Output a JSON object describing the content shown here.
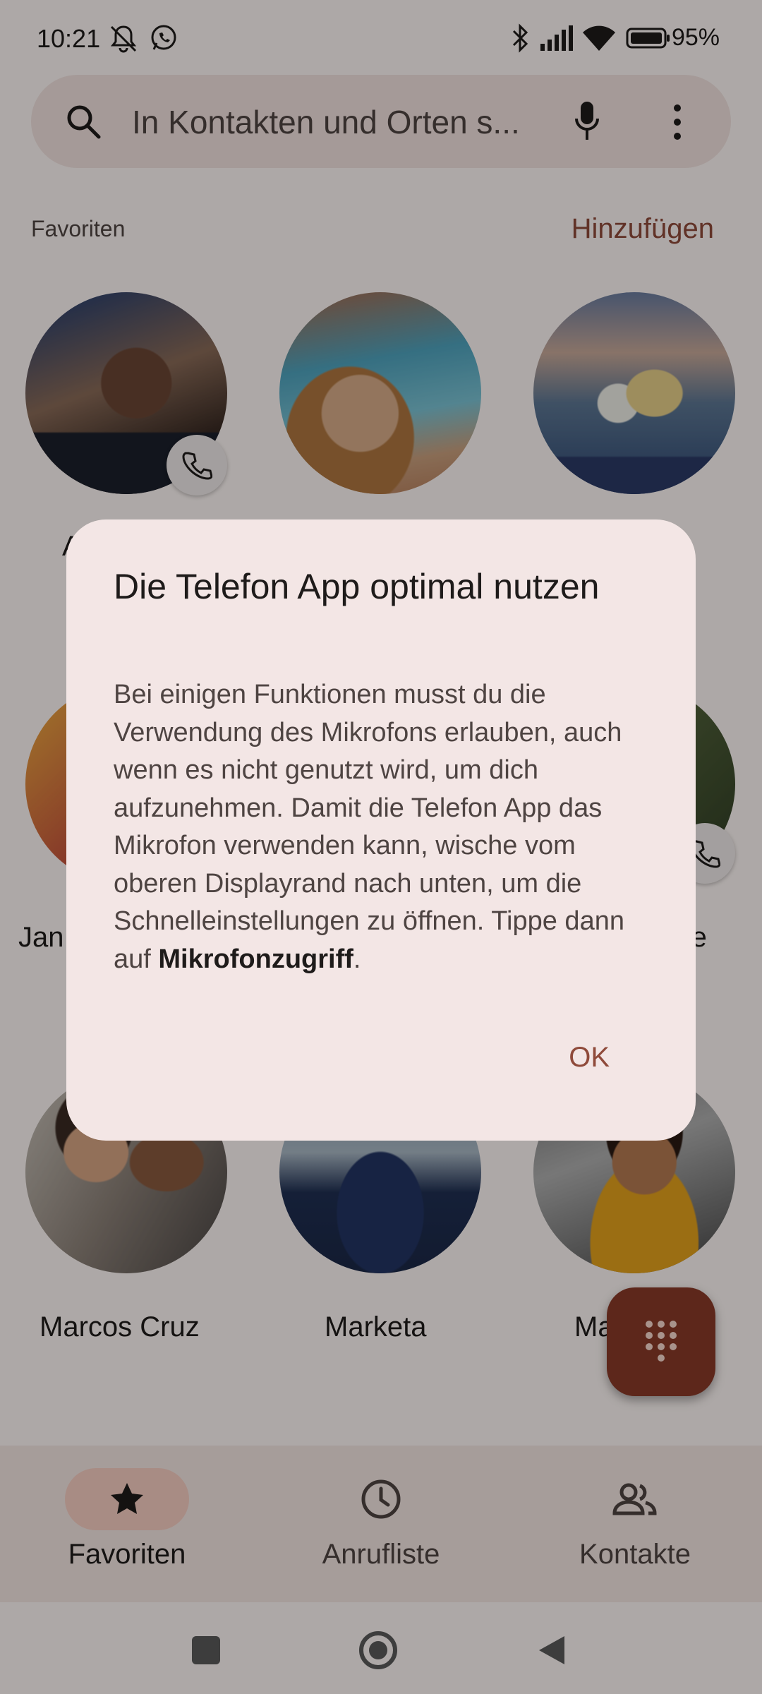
{
  "status_bar": {
    "time": "10:21",
    "battery": "95%"
  },
  "search": {
    "placeholder": "In Kontakten und Orten s..."
  },
  "favorites": {
    "header": "Favoriten",
    "add_label": "Hinzufügen"
  },
  "contacts": [
    {
      "name": "A",
      "has_call_badge": true
    },
    {
      "name": "",
      "has_call_badge": false
    },
    {
      "name": "",
      "has_call_badge": false
    },
    {
      "name": "Jan",
      "has_call_badge": false
    },
    {
      "name": "",
      "has_call_badge": false
    },
    {
      "name": "rde",
      "has_call_badge": true
    },
    {
      "name": "Marcos Cruz",
      "has_call_badge": false
    },
    {
      "name": "Marketa",
      "has_call_badge": false
    },
    {
      "name": "Ma",
      "has_call_badge": false
    }
  ],
  "dialog": {
    "title": "Die Telefon App optimal nutzen",
    "body_text": "Bei einigen Funktionen musst du die Verwendung des Mikrofons erlauben, auch wenn es nicht genutzt wird, um dich aufzunehmen. Damit die Telefon App das Mikrofon verwenden kann, wische vom oberen Displayrand nach unten, um die Schnelleinstellungen zu öffnen. Tippe dann auf",
    "body_bold": "Mikrofonzugriff",
    "body_end": ".",
    "ok_label": "OK"
  },
  "bottom_nav": {
    "items": [
      {
        "label": "Favoriten",
        "icon": "star-icon",
        "active": true
      },
      {
        "label": "Anrufliste",
        "icon": "clock-icon",
        "active": false
      },
      {
        "label": "Kontakte",
        "icon": "contacts-icon",
        "active": false
      }
    ]
  },
  "colors": {
    "accent": "#8f4a3a",
    "fab": "#8a3a28",
    "dialog_bg": "#f3e6e5"
  }
}
